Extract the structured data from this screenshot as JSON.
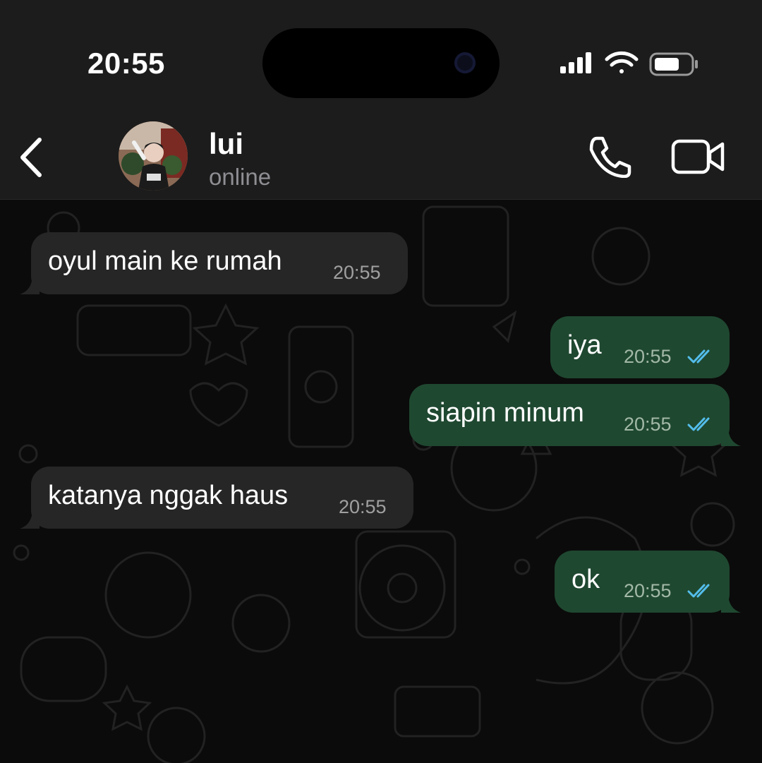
{
  "status_bar": {
    "time": "20:55"
  },
  "header": {
    "contact_name": "lui",
    "contact_status": "online"
  },
  "messages": [
    {
      "direction": "incoming",
      "text": "oyul main ke rumah",
      "time": "20:55"
    },
    {
      "direction": "outgoing",
      "text": "iya",
      "time": "20:55",
      "read": true
    },
    {
      "direction": "outgoing",
      "text": "siapin minum",
      "time": "20:55",
      "read": true
    },
    {
      "direction": "incoming",
      "text": "katanya nggak haus",
      "time": "20:55"
    },
    {
      "direction": "outgoing",
      "text": "ok",
      "time": "20:55",
      "read": true
    }
  ],
  "colors": {
    "incoming_bubble": "#262626",
    "outgoing_bubble": "#1f4830",
    "read_ticks": "#53bdeb",
    "header_bg": "#1c1c1c"
  },
  "icons": {
    "back": "chevron-left-icon",
    "call": "phone-icon",
    "video": "video-camera-icon",
    "signal": "cellular-signal-icon",
    "wifi": "wifi-icon",
    "battery": "battery-icon",
    "read_receipt": "double-check-icon"
  }
}
